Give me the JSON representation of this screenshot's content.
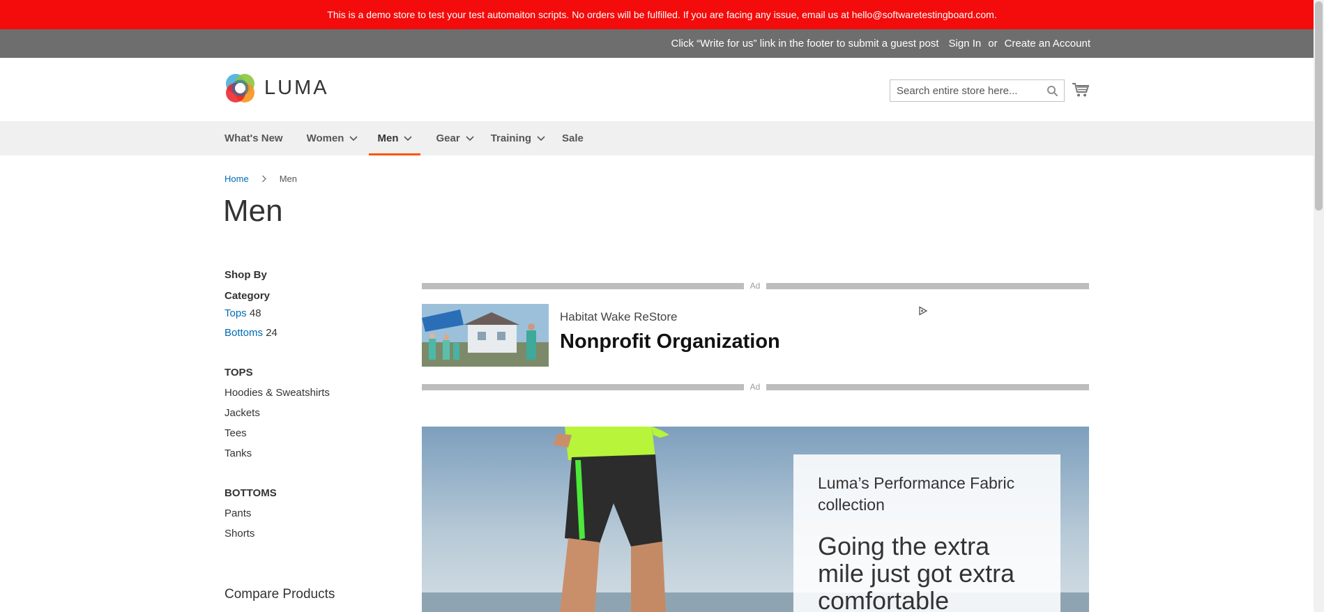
{
  "demo_notice": "This is a demo store to test your test automaiton scripts. No orders will be fulfilled. If you are facing any issue, email us at hello@softwaretestingboard.com.",
  "panel": {
    "promo": "Click “Write for us” link in the footer to submit a guest post",
    "sign_in": "Sign In",
    "or": "or",
    "create_account": "Create an Account"
  },
  "header": {
    "logo_text": "LUMA",
    "search_placeholder": "Search entire store here..."
  },
  "nav": {
    "items": [
      {
        "label": "What's New"
      },
      {
        "label": "Women"
      },
      {
        "label": "Men"
      },
      {
        "label": "Gear"
      },
      {
        "label": "Training"
      },
      {
        "label": "Sale"
      }
    ]
  },
  "breadcrumb": {
    "home": "Home",
    "current": "Men"
  },
  "page_title": "Men",
  "sidebar": {
    "shop_by": "Shop By",
    "category_title": "Category",
    "categories": [
      {
        "label": "Tops",
        "count": "48"
      },
      {
        "label": "Bottoms",
        "count": "24"
      }
    ],
    "tops_heading": "TOPS",
    "tops_items": [
      "Hoodies & Sweatshirts",
      "Jackets",
      "Tees",
      "Tanks"
    ],
    "bottoms_heading": "BOTTOMS",
    "bottoms_items": [
      "Pants",
      "Shorts"
    ],
    "compare": "Compare Products"
  },
  "ad": {
    "label": "Ad",
    "advertiser": "Habitat Wake ReStore",
    "headline": "Nonprofit Organization"
  },
  "hero": {
    "subtitle": "Luma’s Performance Fabric collection",
    "title": "Going the extra mile just got extra comfortable"
  }
}
